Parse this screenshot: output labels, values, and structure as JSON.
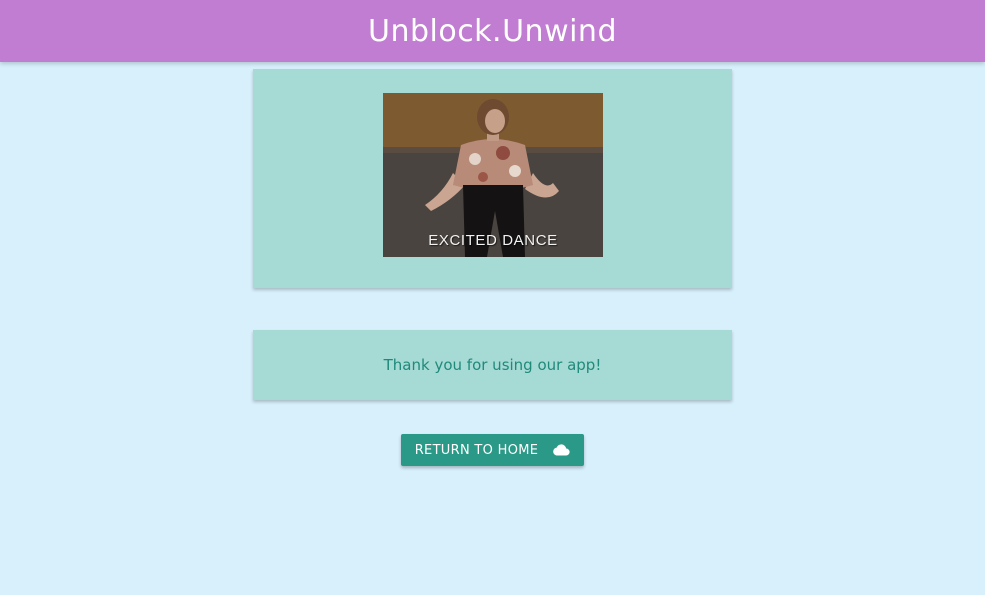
{
  "header": {
    "title": "Unblock.Unwind"
  },
  "gif_card": {
    "caption": "EXCITED DANCE"
  },
  "message_card": {
    "text": "Thank you for using our app!"
  },
  "return_button": {
    "label": "RETURN TO HOME",
    "icon": "cloud-icon"
  },
  "colors": {
    "header": "#c17dd1",
    "background": "#d8f0fc",
    "card": "#a6dad5",
    "button": "#2a9987",
    "message_text": "#1f8a7b"
  }
}
